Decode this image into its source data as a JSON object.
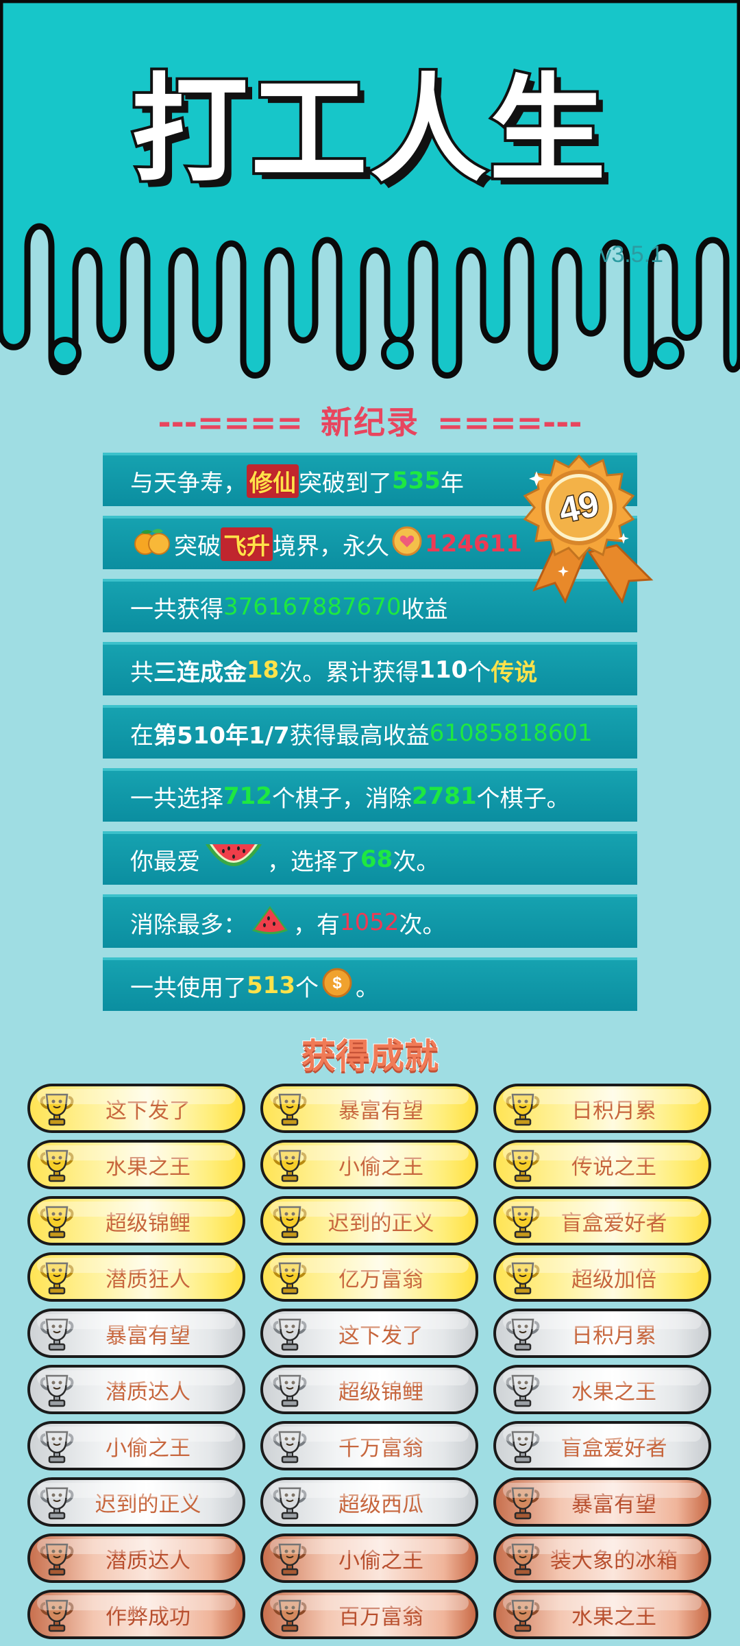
{
  "app": {
    "title": "打工人生",
    "version": "v3.5.1"
  },
  "records": {
    "heading_left": "---====",
    "heading_word": "新纪录",
    "heading_right": "====---",
    "medal_number": "49",
    "rows": [
      {
        "parts": [
          "与天争寿，",
          "修仙",
          "突破到了",
          "535",
          "年"
        ]
      },
      {
        "parts": [
          "突破",
          "飞升",
          "境界，永久",
          "124611"
        ]
      },
      {
        "parts": [
          "一共获得",
          "376167887670",
          "收益"
        ]
      },
      {
        "parts": [
          "共",
          "三连成金",
          "18",
          "次。累计获得",
          "110",
          "个",
          "传说"
        ]
      },
      {
        "parts": [
          "在 ",
          "第510年1/7",
          " 获得最高收益",
          "61085818601"
        ]
      },
      {
        "parts": [
          "一共选择",
          "712",
          "个棋子，消除",
          "2781",
          "个棋子。"
        ]
      },
      {
        "parts": [
          "你最爱",
          "，选择了",
          "68",
          "次。"
        ]
      },
      {
        "parts": [
          "消除最多：",
          "，有",
          "1052",
          "次。"
        ]
      },
      {
        "parts": [
          "一共使用了",
          "513",
          "个",
          "。"
        ]
      }
    ]
  },
  "achievements": {
    "heading": "获得成就",
    "items": [
      {
        "label": "这下发了",
        "tier": "gold"
      },
      {
        "label": "暴富有望",
        "tier": "gold"
      },
      {
        "label": "日积月累",
        "tier": "gold"
      },
      {
        "label": "水果之王",
        "tier": "gold"
      },
      {
        "label": "小偷之王",
        "tier": "gold"
      },
      {
        "label": "传说之王",
        "tier": "gold"
      },
      {
        "label": "超级锦鲤",
        "tier": "gold"
      },
      {
        "label": "迟到的正义",
        "tier": "gold"
      },
      {
        "label": "盲盒爱好者",
        "tier": "gold"
      },
      {
        "label": "潜质狂人",
        "tier": "gold"
      },
      {
        "label": "亿万富翁",
        "tier": "gold"
      },
      {
        "label": "超级加倍",
        "tier": "gold"
      },
      {
        "label": "暴富有望",
        "tier": "silver"
      },
      {
        "label": "这下发了",
        "tier": "silver"
      },
      {
        "label": "日积月累",
        "tier": "silver"
      },
      {
        "label": "潜质达人",
        "tier": "silver"
      },
      {
        "label": "超级锦鲤",
        "tier": "silver"
      },
      {
        "label": "水果之王",
        "tier": "silver"
      },
      {
        "label": "小偷之王",
        "tier": "silver"
      },
      {
        "label": "千万富翁",
        "tier": "silver"
      },
      {
        "label": "盲盒爱好者",
        "tier": "silver"
      },
      {
        "label": "迟到的正义",
        "tier": "silver"
      },
      {
        "label": "超级西瓜",
        "tier": "silver"
      },
      {
        "label": "暴富有望",
        "tier": "bronze"
      },
      {
        "label": "潜质达人",
        "tier": "bronze"
      },
      {
        "label": "小偷之王",
        "tier": "bronze"
      },
      {
        "label": "装大象的冰箱",
        "tier": "bronze"
      },
      {
        "label": "作弊成功",
        "tier": "bronze"
      },
      {
        "label": "百万富翁",
        "tier": "bronze"
      },
      {
        "label": "水果之王",
        "tier": "bronze"
      }
    ]
  },
  "colors": {
    "header_teal": "#17c6c9",
    "bg": "#9fdde3",
    "row_teal": "#0f98a8",
    "green": "#1ee841",
    "yellow": "#ffe24a",
    "red": "#ee3a54"
  },
  "icons": {
    "row2": "tangerine-icon",
    "row2b": "heart-coin-icon",
    "row7": "watermelon-slice-icon",
    "row8": "watermelon-wedge-icon",
    "row9": "dollar-coin-icon",
    "medal": "rosette-medal-icon",
    "achievement": "trophy-icon"
  }
}
